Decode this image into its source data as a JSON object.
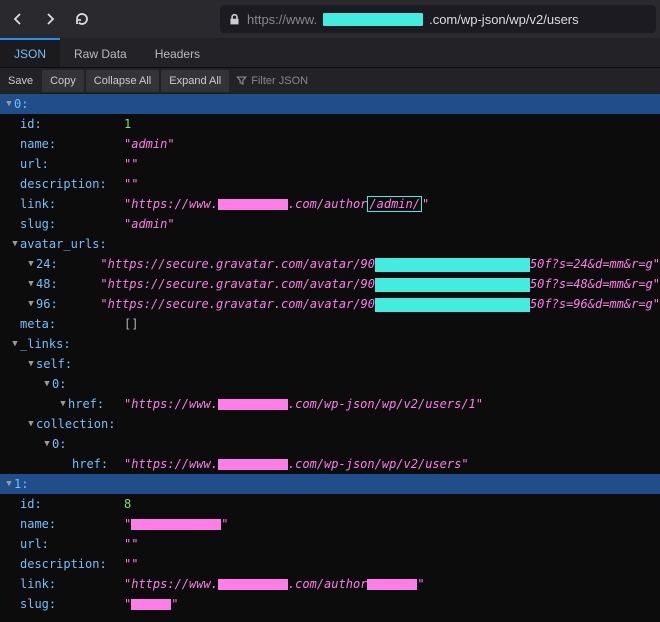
{
  "nav": {
    "back": "←",
    "forward": "→",
    "reload": "⟳",
    "url_prefix": "https://www.",
    "url_suffix": ".com/wp-json/wp/v2/users"
  },
  "tabs": {
    "json": "JSON",
    "raw": "Raw Data",
    "headers": "Headers"
  },
  "toolbar": {
    "save": "Save",
    "copy": "Copy",
    "collapse": "Collapse All",
    "expand": "Expand All",
    "filter_placeholder": "Filter JSON"
  },
  "tree": {
    "idx0": "0:",
    "id": {
      "k": "id:",
      "v": "1"
    },
    "name": {
      "k": "name:",
      "v": "\"admin\""
    },
    "url": {
      "k": "url:",
      "v": "\"\""
    },
    "description": {
      "k": "description:",
      "v": "\"\""
    },
    "link": {
      "k": "link:",
      "p1": "\"https://www.",
      "p2": ".com/author",
      "p3": "/admin/",
      "p4": "\""
    },
    "slug": {
      "k": "slug:",
      "v": "\"admin\""
    },
    "avatar": {
      "k": "avatar_urls:",
      "r24": {
        "k": "24:",
        "p1": "\"https://secure.gravatar.com/avatar/90",
        "p2": "50f?s=24&d=mm&r=g\""
      },
      "r48": {
        "k": "48:",
        "p1": "\"https://secure.gravatar.com/avatar/90",
        "p2": "50f?s=48&d=mm&r=g\""
      },
      "r96": {
        "k": "96:",
        "p1": "\"https://secure.gravatar.com/avatar/90",
        "p2": "50f?s=96&d=mm&r=g\""
      }
    },
    "meta": {
      "k": "meta:",
      "v": "[]"
    },
    "links": {
      "k": "_links:",
      "self": {
        "k": "self:",
        "idx": "0:",
        "href": "href:",
        "p1": "\"https://www.",
        "p2": ".com/wp-json/wp/v2/users/1\""
      },
      "coll": {
        "k": "collection:",
        "idx": "0:",
        "href": "href:",
        "p1": "\"https://www.",
        "p2": ".com/wp-json/wp/v2/users\""
      }
    },
    "idx1": "1:",
    "u1": {
      "id": {
        "k": "id:",
        "v": "8"
      },
      "name": {
        "k": "name:",
        "q": "\""
      },
      "url": {
        "k": "url:",
        "v": "\"\""
      },
      "description": {
        "k": "description:",
        "v": "\"\""
      },
      "link": {
        "k": "link:",
        "p1": "\"https://www.",
        "p2": ".com/author",
        "p3": "\""
      },
      "slug": {
        "k": "slug:",
        "q": "\""
      }
    }
  }
}
